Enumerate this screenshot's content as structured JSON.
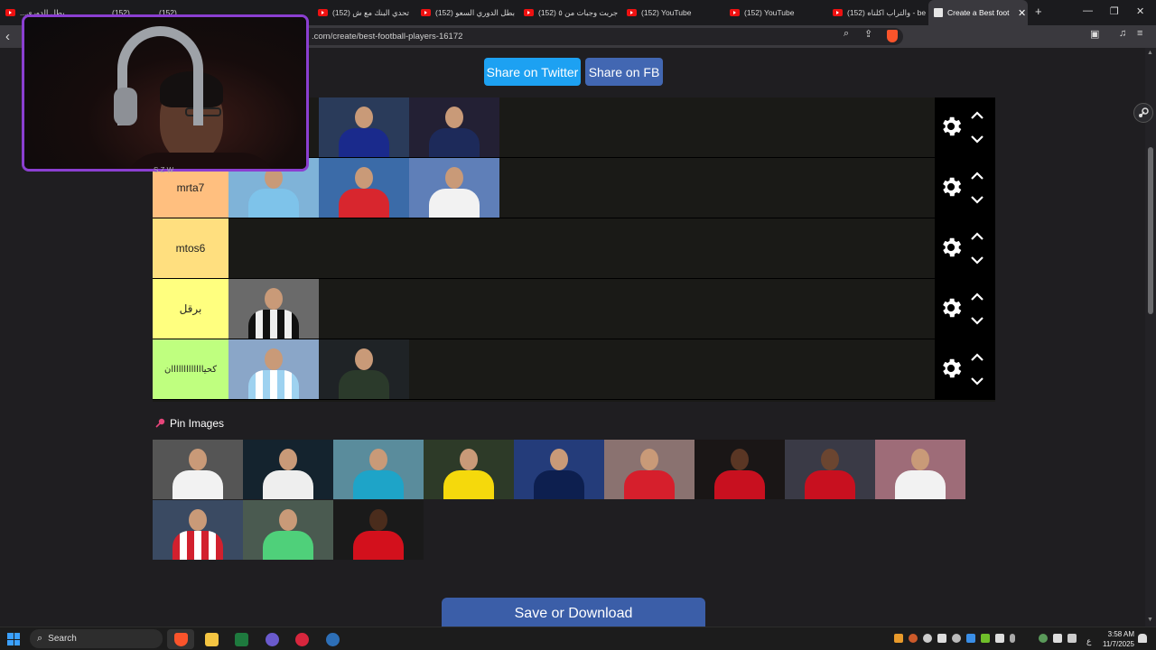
{
  "browser": {
    "tabs": [
      {
        "title": "...بطل الدوري",
        "active": false
      },
      {
        "title": "(152) ...",
        "active": false
      },
      {
        "title": "(152) ...",
        "active": false
      },
      {
        "title": "(152) تحدي البنك مع ش",
        "active": false
      },
      {
        "title": "(152) بطل الدوري السعو",
        "active": false
      },
      {
        "title": "(152) جربت وجبات من ٥",
        "active": false
      },
      {
        "title": "(152) YouTube",
        "active": false
      },
      {
        "title": "(152) YouTube",
        "active": false
      },
      {
        "title": "(152) والتراب اكلناه - be",
        "active": false
      },
      {
        "title": "Create a Best foot",
        "active": true
      }
    ],
    "new_tab_symbol": "+",
    "url": ".com/create/best-football-players-16172"
  },
  "page": {
    "share_twitter": "Share on Twitter",
    "share_fb": "Share on FB",
    "tiers": [
      {
        "label": "",
        "color": "#ff7f7f",
        "images": 2
      },
      {
        "label": "mrta7",
        "color": "#ffbf7f",
        "images": 3
      },
      {
        "label": "mtos6",
        "color": "#ffdf7f",
        "images": 0
      },
      {
        "label": "برقل",
        "color": "#ffff7f",
        "images": 1
      },
      {
        "label": "كحيااااااااااااان",
        "color": "#bfff7f",
        "images": 2
      }
    ],
    "pin_images_label": "Pin Images",
    "pool_count": 12,
    "save_button": "Save or Download"
  },
  "webcam": {
    "caption": "S Z W"
  },
  "taskbar": {
    "search_label": "Search",
    "time": "3:58 AM",
    "date": "11/7/2025",
    "lang": "ع"
  },
  "colors": {
    "accent_purple": "#8b3fd1",
    "twitter_blue": "#1da1f2",
    "fb_blue": "#4267b2",
    "save_blue": "#3b5ea8"
  }
}
